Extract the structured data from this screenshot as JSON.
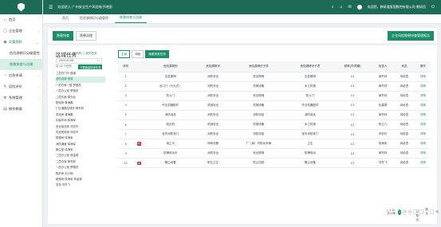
{
  "sidebar": {
    "items": [
      {
        "icon": "⌂",
        "label": "首页"
      },
      {
        "icon": "▢",
        "label": "企业管理",
        "chev": "›"
      },
      {
        "icon": "◉",
        "label": "双重预防",
        "chev": "⌄",
        "open": true
      },
      {
        "label": "危险源辨识分级管控",
        "sub": true
      },
      {
        "label": "隐患排查与治理",
        "sub": true,
        "active": true
      },
      {
        "icon": "◔",
        "label": "应急申请",
        "chev": "›"
      },
      {
        "icon": "✎",
        "label": "风险评价",
        "chev": "›"
      },
      {
        "icon": "⚙",
        "label": "系统管理",
        "chev": "›"
      },
      {
        "icon": "▤",
        "label": "操作数据"
      }
    ]
  },
  "topbar": {
    "menu_icon": "☰",
    "title": "欢迎进入 广州安全生产风险电子地图",
    "user_text": "欢迎您，教研道复国数控有限公司·教研员",
    "logout_icon": "⏻"
  },
  "tabs": [
    {
      "label": "首页"
    },
    {
      "label": "危险源辨识分级管控"
    },
    {
      "label": "隐患排查与治理",
      "active": true
    }
  ],
  "filterbar": {
    "btn_all": "隐患排查",
    "btn_manage": "隐患治理",
    "btn_right": "企业风险隐患排查管理报告"
  },
  "region": {
    "title": "区域任务",
    "sub_label": "全机构",
    "sub_green": "◎ 我的任务",
    "date": "2023-02-08",
    "cal_icon": "▭",
    "date_row2": "共 31 个任务",
    "date_btn": "下载隐患排查任务",
    "tree": [
      {
        "label": "二层仓门厅·楼道"
      },
      {
        "label": "消防设施·喷淋",
        "hl": true
      },
      {
        "label": "一层仓库一楼·罗茜蕊"
      },
      {
        "label": "一层办公室·罗茜蕊"
      },
      {
        "label": "二层东面·周大仙"
      },
      {
        "label": "配电房·蒋海鹏"
      },
      {
        "label": "厂区道路及绿化·蒋冬林"
      },
      {
        "label": "发电房·蒋海鹏"
      },
      {
        "label": "包装车间·徐海军"
      },
      {
        "label": "危化品仓库·邓亚玲"
      },
      {
        "label": "实验室用房·邓亚玲"
      },
      {
        "label": "楼梯间·徐海军"
      },
      {
        "label": "消防通道·徐海军"
      },
      {
        "label": "降尘室·徐海军"
      },
      {
        "label": "二层办公室·林金城"
      },
      {
        "label": "二层仓库·蒋冬林"
      },
      {
        "label": "一层办公室·罗茜蕊"
      },
      {
        "label": "锅炉房·刘小明"
      },
      {
        "label": "楼梯间·徐海军·林金城"
      },
      {
        "label": "总务·刘冬飞"
      }
    ]
  },
  "tools": {
    "all": "全部",
    "pending": "待检",
    "export": "隐患排查任务"
  },
  "table": {
    "headers": [
      "序号",
      "",
      "危险源类别",
      "危险源辨识",
      "危险源辨识子项",
      "危险源辨识子项",
      "频率(次/周期)",
      "检查人",
      "状态",
      "操作"
    ],
    "rows": [
      [
        "1",
        "",
        "应急照明",
        "消防安全",
        "安全照明",
        "应急照明",
        "1/1",
        "蒋冬林",
        "待检查",
        "详情"
      ],
      [
        "2",
        "",
        "出口门（行为式）",
        "消防安全",
        "机械设备",
        "木工机械",
        "1/1",
        "蒋冬林",
        "待检查",
        "详情"
      ],
      [
        "3",
        "",
        "防火门",
        "消防安全",
        "安全照明",
        "防火门",
        "1/1",
        "蒋冬林",
        "待检查",
        "详情"
      ],
      [
        "4",
        "",
        "作业机器配件",
        "机械安全",
        "机械设备",
        "作业机器配件",
        "1/1",
        "包建勇",
        "待检查",
        "详情"
      ],
      [
        "5",
        "",
        "消防用品",
        "消防安全",
        "消防用品",
        "消防用品",
        "1/1",
        "蒋冬林",
        "待检查",
        "详情"
      ],
      [
        "6",
        "",
        "制边机",
        "机械安全",
        "机械设备",
        "木工机械",
        "1/1",
        "陈立凡",
        "待检查",
        "详情"
      ],
      [
        "7",
        "",
        "室内消防栓门",
        "消防安全",
        "消防用品",
        "室内消防栓门",
        "1/1",
        "邓亚玲",
        "待检查",
        "详情"
      ],
      [
        "8",
        "8",
        "电工头",
        "特种设备",
        "厂（库）内机动车辆",
        "卫生",
        "1/1",
        "徐海军",
        "待检查",
        "详情"
      ],
      [
        "9",
        "",
        "防爆电动手",
        "消防安全",
        "安全照明",
        "防爆电动",
        "1/1",
        "蒋冬林",
        "待检查",
        "详情"
      ],
      [
        "10",
        "8",
        "降尘设备",
        "职业卫生",
        "防尘控制",
        "降尘设备",
        "1/1",
        "刘冬飞",
        "待检查",
        "详情"
      ]
    ]
  },
  "pager": {
    "total": "< 1-10 共12条",
    "pages": [
      "1",
      "2"
    ],
    "next": ">",
    "page_size": "10 条/页",
    "goto": "跳至",
    "unit": "页"
  },
  "colors": {
    "accent": "#1a8f6a",
    "topbar": "#1d6b57",
    "tag": "#e23c3c"
  }
}
